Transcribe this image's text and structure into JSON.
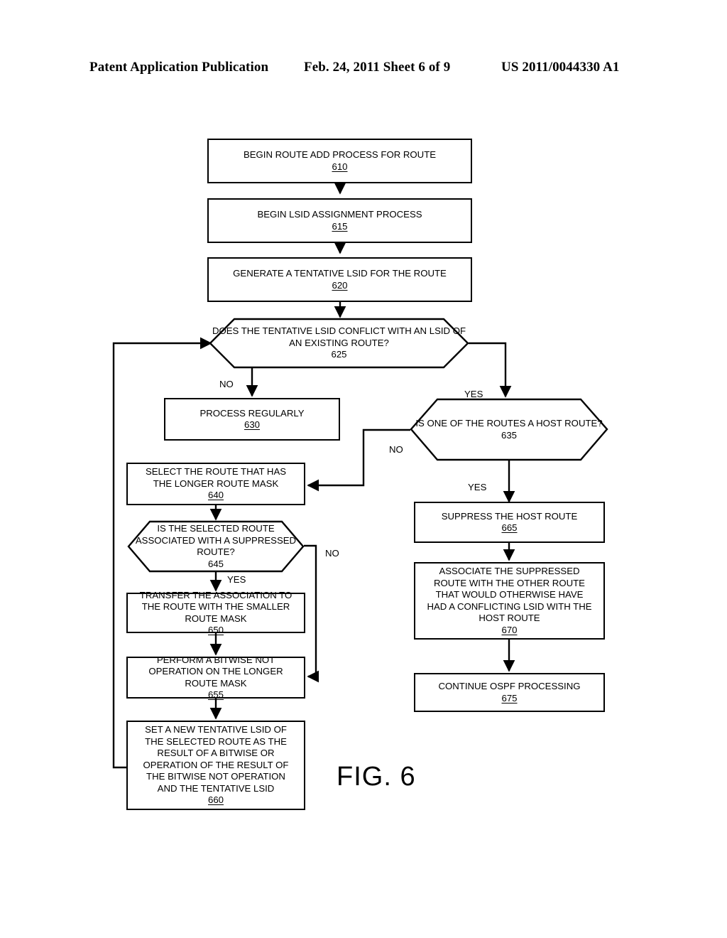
{
  "header": {
    "left": "Patent Application Publication",
    "middle": "Feb. 24, 2011  Sheet 6 of 9",
    "right": "US 2011/0044330 A1"
  },
  "figure": {
    "caption": "FIG. 6",
    "type": "flowchart"
  },
  "nodes": {
    "n610": {
      "text": "BEGIN ROUTE ADD PROCESS FOR ROUTE",
      "ref": "610",
      "shape": "rect"
    },
    "n615": {
      "text": "BEGIN LSID ASSIGNMENT PROCESS",
      "ref": "615",
      "shape": "rect"
    },
    "n620": {
      "text": "GENERATE A TENTATIVE LSID FOR THE ROUTE",
      "ref": "620",
      "shape": "rect"
    },
    "n625": {
      "text": "DOES THE TENTATIVE LSID  CONFLICT WITH\nAN LSID OF AN EXISTING ROUTE?",
      "ref": "625",
      "shape": "hexagon"
    },
    "n630": {
      "text": "PROCESS REGULARLY",
      "ref": "630",
      "shape": "rect"
    },
    "n635": {
      "text": "IS ONE OF THE ROUTES A\nHOST ROUTE?",
      "ref": "635",
      "shape": "hexagon"
    },
    "n640": {
      "text": "SELECT THE ROUTE THAT HAS\nTHE LONGER ROUTE MASK",
      "ref": "640",
      "shape": "rect"
    },
    "n645": {
      "text": "IS THE SELECTED ROUTE\nASSOCIATED WITH A\nSUPPRESSED ROUTE?",
      "ref": "645",
      "shape": "hexagon"
    },
    "n650": {
      "text": "TRANSFER THE ASSOCIATION TO\nTHE ROUTE WITH THE SMALLER\nROUTE MASK ",
      "ref": "650",
      "shape": "rect"
    },
    "n655": {
      "text": "PERFORM A BITWISE NOT\nOPERATION ON THE LONGER\nROUTE MASK ",
      "ref": "655",
      "shape": "rect"
    },
    "n660": {
      "text": "SET A NEW TENTATIVE LSID OF\nTHE SELECTED ROUTE AS THE\nRESULT OF A BITWISE OR\nOPERATION OF THE RESULT OF\nTHE BITWISE NOT OPERATION\nAND THE TENTATIVE LSID",
      "ref": "660",
      "shape": "rect"
    },
    "n665": {
      "text": "SUPPRESS THE HOST ROUTE",
      "ref": "665",
      "shape": "rect"
    },
    "n670": {
      "text": "ASSOCIATE THE SUPPRESSED\nROUTE WITH THE OTHER ROUTE\nTHAT WOULD OTHERWISE HAVE\nHAD A CONFLICTING LSID WITH THE\nHOST ROUTE",
      "ref": "670",
      "shape": "rect"
    },
    "n675": {
      "text": "CONTINUE OSPF PROCESSING",
      "ref": "675",
      "shape": "rect"
    }
  },
  "edge_labels": {
    "e625_no": "NO",
    "e625_yes": "YES",
    "e635_no": "NO",
    "e635_yes": "YES",
    "e645_no": "NO",
    "e645_yes": "YES"
  },
  "colors": {
    "stroke": "#000000",
    "background": "#ffffff"
  }
}
